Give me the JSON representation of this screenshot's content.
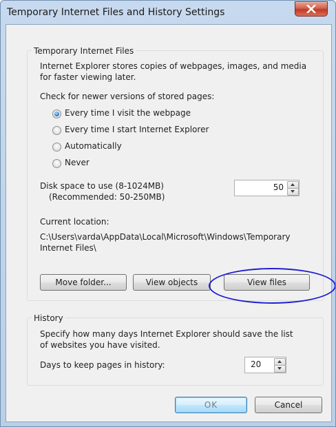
{
  "window": {
    "title": "Temporary Internet Files and History Settings",
    "close_icon": "close-icon"
  },
  "tif_group": {
    "label": "Temporary Internet Files",
    "description_line1": "Internet Explorer stores copies of webpages, images, and media",
    "description_line2": "for faster viewing later.",
    "check_label": "Check for newer versions of stored pages:",
    "options": [
      {
        "label": "Every time I visit the webpage",
        "checked": true
      },
      {
        "label": "Every time I start Internet Explorer",
        "checked": false
      },
      {
        "label": "Automatically",
        "checked": false
      },
      {
        "label": "Never",
        "checked": false
      }
    ],
    "disk_label": "Disk space to use (8-1024MB)",
    "disk_recommended": "(Recommended: 50-250MB)",
    "disk_value": "50",
    "location_label": "Current location:",
    "location_path_line1": "C:\\Users\\varda\\AppData\\Local\\Microsoft\\Windows\\Temporary",
    "location_path_line2": "Internet Files\\",
    "buttons": {
      "move": "Move folder...",
      "view_objects": "View objects",
      "view_files": "View files"
    }
  },
  "history_group": {
    "label": "History",
    "description_line1": "Specify how many days Internet Explorer should save the list",
    "description_line2": "of websites you have visited.",
    "days_label": "Days to keep pages in history:",
    "days_value": "20"
  },
  "footer": {
    "ok": "OK",
    "cancel": "Cancel"
  },
  "annotation": {
    "color": "#1f1fd0"
  }
}
